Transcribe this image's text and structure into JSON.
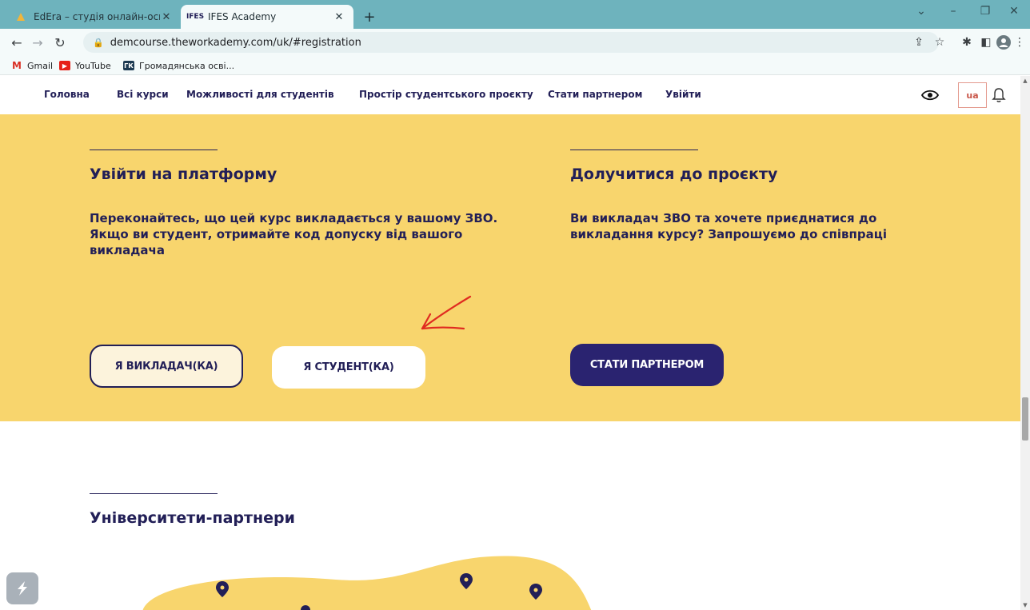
{
  "browser": {
    "tabs": [
      {
        "title": "EdEra – студія онлайн-освіти",
        "active": false
      },
      {
        "title": "IFES Academy",
        "favicon_text": "IFES",
        "active": true
      }
    ],
    "url": "demcourse.theworkademy.com/uk/#registration",
    "bookmarks": [
      {
        "label": "Gmail"
      },
      {
        "label": "YouTube"
      },
      {
        "label": "Громадянська осві..."
      }
    ]
  },
  "site_nav": {
    "links": [
      "Головна",
      "Всі курси",
      "Можливості для студентів",
      "Простір студентського проєкту",
      "Стати партнером",
      "Увійти"
    ],
    "language": "ua"
  },
  "login_section": {
    "title": "Увійти на платформу",
    "description": "Переконайтесь, що цей курс викладається у вашому ЗВО. Якщо ви студент, отримайте код допуску від вашого викладача",
    "teacher_button": "Я ВИКЛАДАЧ(КА)",
    "student_button": "Я СТУДЕНТ(КА)"
  },
  "join_section": {
    "title": "Долучитися до проєкту",
    "description": "Ви викладач ЗВО та хочете приєднатися до викладання курсу? Запрошуємо до співпраці",
    "partner_button": "СТАТИ ПАРТНЕРОМ"
  },
  "partners_section": {
    "title": "Університети-партнери"
  },
  "colors": {
    "brand_dark": "#221f57",
    "yellow_bg": "#f8d56d",
    "button_dark": "#2a2370",
    "annotation_red": "#e02b20"
  }
}
